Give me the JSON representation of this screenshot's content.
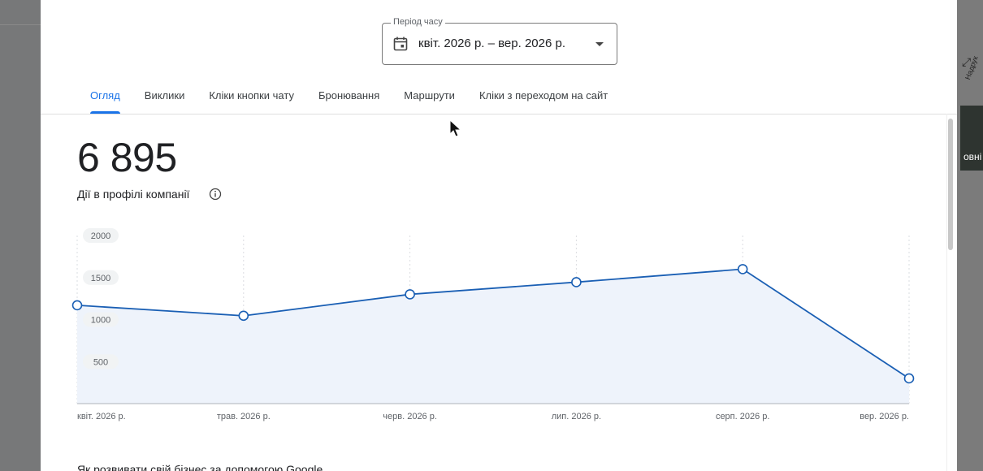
{
  "background": {
    "photo_label": "овні",
    "map_label": "Надрук"
  },
  "period": {
    "legend": "Період часу",
    "value": "квіт. 2026 р. – вер. 2026 р."
  },
  "tabs": [
    {
      "label": "Огляд",
      "active": true
    },
    {
      "label": "Виклики",
      "active": false
    },
    {
      "label": "Кліки кнопки чату",
      "active": false
    },
    {
      "label": "Бронювання",
      "active": false
    },
    {
      "label": "Маршрути",
      "active": false
    },
    {
      "label": "Кліки з переходом на сайт",
      "active": false
    }
  ],
  "summary": {
    "total": "6 895",
    "label": "Дії в профілі компанії"
  },
  "chart_data": {
    "type": "area",
    "categories": [
      "квіт. 2026 р.",
      "трав. 2026 р.",
      "черв. 2026 р.",
      "лип. 2026 р.",
      "серп. 2026 р.",
      "вер. 2026 р."
    ],
    "values": [
      1170,
      1045,
      1300,
      1445,
      1600,
      300
    ],
    "yticks": [
      2000,
      1500,
      1000,
      500
    ],
    "ylim": [
      0,
      2000
    ],
    "line_color": "#1a5fb4",
    "fill_color": "#eef3fb",
    "grid": "vertical-dashed"
  },
  "bottom": {
    "heading": "Як розвивати свій бізнес за допомогою Google"
  },
  "colors": {
    "accent": "#1a73e8",
    "text": "#202124"
  }
}
